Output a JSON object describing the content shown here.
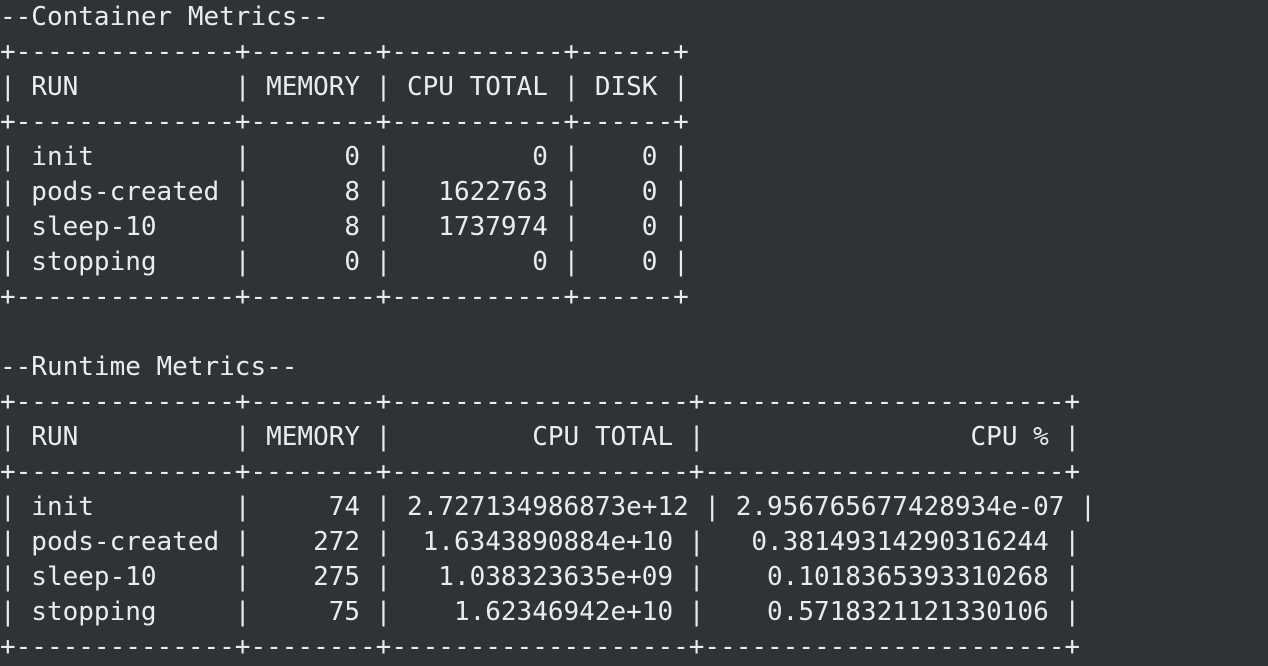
{
  "container": {
    "heading": "--Container Metrics--",
    "border": "+--------------+--------+-----------+------+",
    "header": "| RUN          | MEMORY | CPU TOTAL | DISK |",
    "rows": [
      "| init         |      0 |         0 |    0 |",
      "| pods-created |      8 |   1622763 |    0 |",
      "| sleep-10     |      8 |   1737974 |    0 |",
      "| stopping     |      0 |         0 |    0 |"
    ]
  },
  "runtime": {
    "heading": "--Runtime Metrics--",
    "border": "+--------------+--------+-------------------+-----------------------+",
    "header": "| RUN          | MEMORY |         CPU TOTAL |                 CPU % |",
    "rows": [
      "| init         |     74 | 2.727134986873e+12 | 2.956765677428934e-07 |",
      "| pods-created |    272 |  1.6343890884e+10 |   0.38149314290316244 |",
      "| sleep-10     |    275 |   1.038323635e+09 |    0.1018365393310268 |",
      "| stopping     |     75 |    1.62346942e+10 |    0.5718321121330106 |"
    ]
  }
}
